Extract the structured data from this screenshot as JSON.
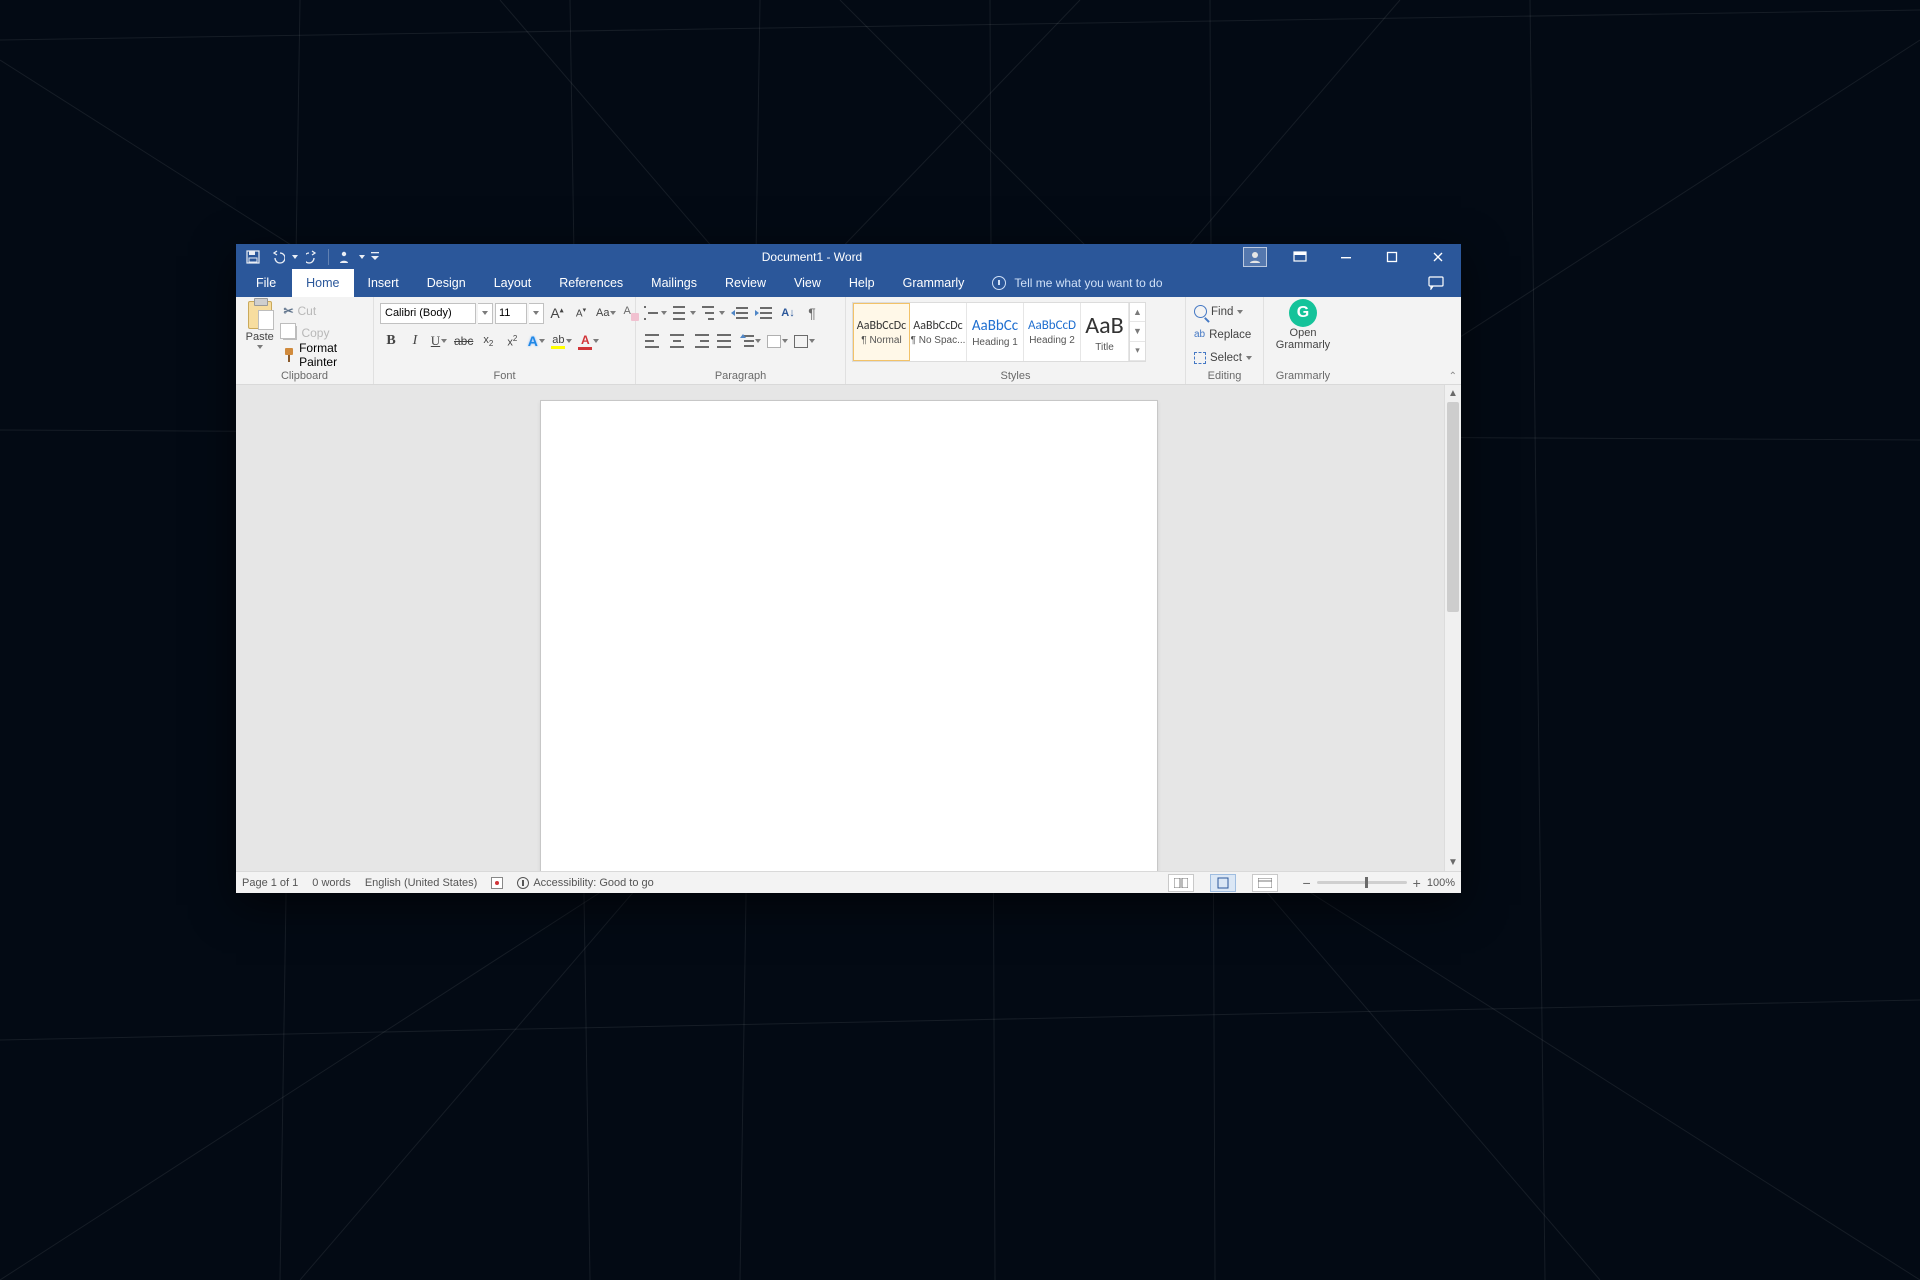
{
  "title": "Document1 - Word",
  "tabs": [
    "File",
    "Home",
    "Insert",
    "Design",
    "Layout",
    "References",
    "Mailings",
    "Review",
    "View",
    "Help",
    "Grammarly"
  ],
  "active_tab": "Home",
  "tellme": "Tell me what you want to do",
  "ribbon": {
    "clipboard": {
      "label": "Clipboard",
      "paste": "Paste",
      "cut": "Cut",
      "copy": "Copy",
      "format_painter": "Format Painter"
    },
    "font": {
      "label": "Font",
      "name": "Calibri (Body)",
      "size": "11"
    },
    "paragraph": {
      "label": "Paragraph"
    },
    "styles": {
      "label": "Styles",
      "items": [
        {
          "sample": "AaBbCcDc",
          "name": "¶ Normal",
          "color": "#3a3a3a",
          "size": "12px",
          "selected": true
        },
        {
          "sample": "AaBbCcDc",
          "name": "¶ No Spac...",
          "color": "#3a3a3a",
          "size": "12px"
        },
        {
          "sample": "AaBbCc",
          "name": "Heading 1",
          "color": "#1f6fd0",
          "size": "15px"
        },
        {
          "sample": "AaBbCcD",
          "name": "Heading 2",
          "color": "#1f6fd0",
          "size": "13px"
        },
        {
          "sample": "AaB",
          "name": "Title",
          "color": "#2a2a2a",
          "size": "24px"
        }
      ]
    },
    "editing": {
      "label": "Editing",
      "find": "Find",
      "replace": "Replace",
      "select": "Select"
    },
    "grammarly": {
      "label": "Grammarly",
      "open1": "Open",
      "open2": "Grammarly"
    }
  },
  "status": {
    "page": "Page 1 of 1",
    "words": "0 words",
    "lang": "English (United States)",
    "accessibility": "Accessibility: Good to go",
    "zoom": "100%"
  }
}
